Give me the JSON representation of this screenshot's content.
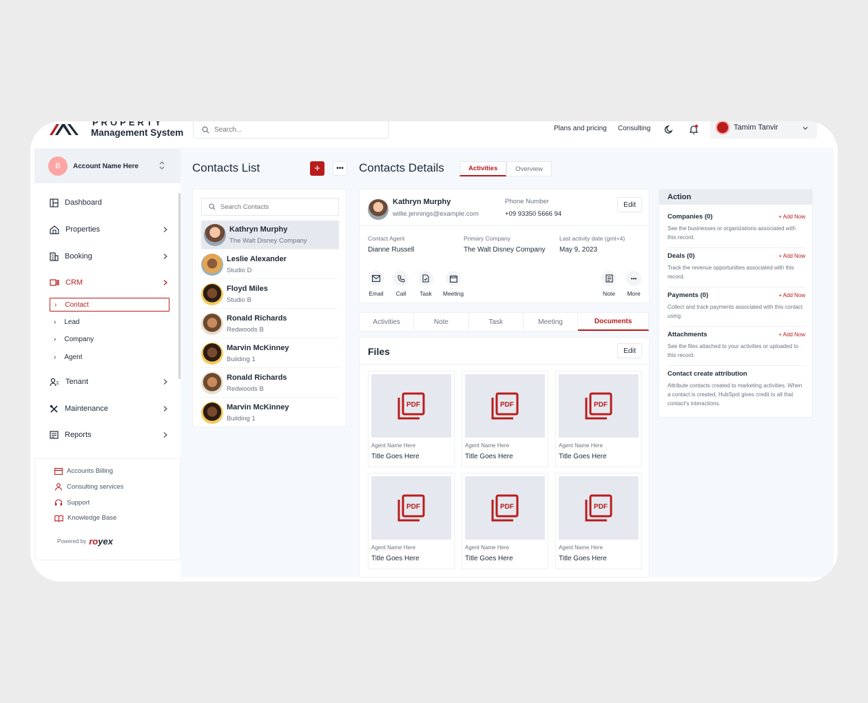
{
  "brand": {
    "line1": "PROPERTY",
    "line2": "Management System"
  },
  "topbar": {
    "search_placeholder": "Search...",
    "links": [
      "Plans and pricing",
      "Consulting"
    ],
    "user_name": "Tamim Tanvir"
  },
  "sidebar": {
    "account_initial": "B",
    "account_name": "Account Name Here",
    "nav": [
      {
        "label": "Dashboard",
        "icon": "dashboard-icon"
      },
      {
        "label": "Properties",
        "icon": "properties-icon"
      },
      {
        "label": "Booking",
        "icon": "building-icon"
      },
      {
        "label": "CRM",
        "icon": "crm-icon"
      },
      {
        "label": "Tenant",
        "icon": "tenant-icon"
      },
      {
        "label": "Maintenance",
        "icon": "tools-icon"
      },
      {
        "label": "Reports",
        "icon": "reports-icon"
      }
    ],
    "crm_sub": [
      "Contact",
      "Lead",
      "Company",
      "Agent"
    ],
    "bottom": [
      "Accounts Billing",
      "Consulting services",
      "Support",
      "Knowledge Base"
    ],
    "powered_by": "Powered by",
    "powered_brand_a": "ro",
    "powered_brand_b": "yex"
  },
  "contacts_list": {
    "title": "Contacts List",
    "search_placeholder": "Search Contacts",
    "items": [
      {
        "name": "Kathryn Murphy",
        "sub": "The Walt Disney Company"
      },
      {
        "name": "Leslie Alexander",
        "sub": "Studio D"
      },
      {
        "name": "Floyd Miles",
        "sub": "Studio B"
      },
      {
        "name": "Ronald Richards",
        "sub": "Redwoods B"
      },
      {
        "name": "Marvin McKinney",
        "sub": "Building 1"
      },
      {
        "name": "Ronald Richards",
        "sub": "Redwoods B"
      },
      {
        "name": "Marvin McKinney",
        "sub": "Building 1"
      }
    ]
  },
  "details": {
    "title": "Contacts Details",
    "tabs": [
      "Activities",
      "Overview"
    ],
    "name": "Kathryn Murphy",
    "email": "willie.jennings@example.com",
    "phone_label": "Phone Number",
    "phone": "+09 93350 5666 94",
    "edit": "Edit",
    "agent_label": "Contact Agent",
    "agent": "Dianne Russell",
    "company_label": "Primary Company",
    "company": "The Walt Disney Company",
    "last_label": "Last activity date (gmt+4)",
    "last": "May 9, 2023",
    "actions": [
      "Email",
      "Call",
      "Task",
      "Meeting",
      "Note",
      "More"
    ],
    "subtabs": [
      "Activities",
      "Note",
      "Task",
      "Meeting",
      "Documents"
    ],
    "files_title": "Files",
    "files_edit": "Edit",
    "file_icon_text": "PDF",
    "files": [
      {
        "agent": "Agent Name Here",
        "title": "Title Goes Here"
      },
      {
        "agent": "Agent Name Here",
        "title": "Title Goes Here"
      },
      {
        "agent": "Agent Name Here",
        "title": "Title Goes Here"
      },
      {
        "agent": "Agent Name Here",
        "title": "Title Goes Here"
      },
      {
        "agent": "Agent Name Here",
        "title": "Title Goes Here"
      },
      {
        "agent": "Agent Name Here",
        "title": "Title Goes Here"
      }
    ]
  },
  "action_panel": {
    "title": "Action",
    "sections": [
      {
        "title": "Companies (0)",
        "add": "+ Add Now",
        "desc": "See the businesses or organizations associated with this record."
      },
      {
        "title": "Deals (0)",
        "add": "+ Add Now",
        "desc": "Track the revenue opportunities associated with this record."
      },
      {
        "title": "Payments (0)",
        "add": "+ Add Now",
        "desc": "Collect and track payments associated with this contact using."
      },
      {
        "title": "Attachments",
        "add": "+ Add Now",
        "desc": "See the files attached to your activities or uploaded to this record."
      },
      {
        "title": "Contact create attribution",
        "add": "",
        "desc": "Attribute contacts created to marketing activities. When a contact is created, HubSpot gives credit to all that contact's interactions."
      }
    ]
  },
  "colors": {
    "accent": "#b91c1c",
    "background": "#f5f8fc",
    "panel": "#ffffff"
  }
}
